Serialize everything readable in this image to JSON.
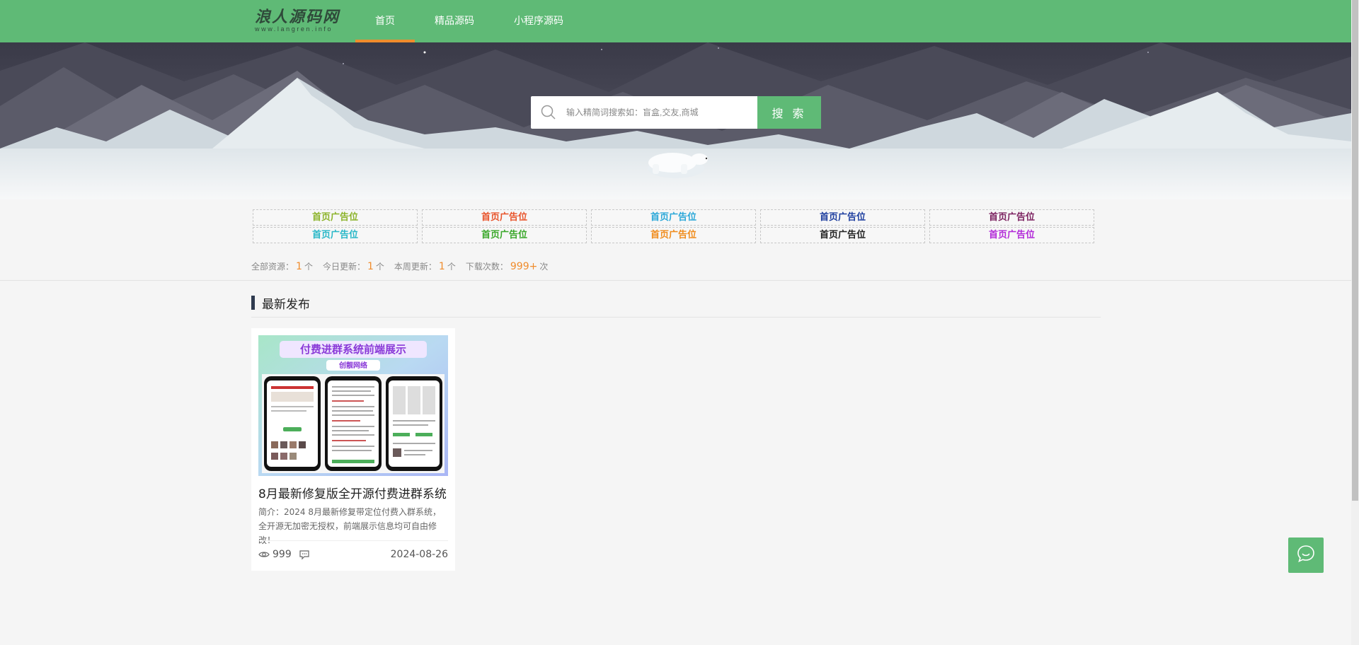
{
  "header": {
    "logo_text": "浪人源码网",
    "logo_sub": "www.langren.info",
    "nav": [
      {
        "label": "首页",
        "active": true
      },
      {
        "label": "精品源码",
        "active": false
      },
      {
        "label": "小程序源码",
        "active": false
      }
    ]
  },
  "search": {
    "placeholder": "输入精简词搜索如：盲盒,交友,商城",
    "button_label": "搜 索"
  },
  "ads": [
    {
      "label": "首页广告位",
      "color": "#8cb32a"
    },
    {
      "label": "首页广告位",
      "color": "#e8532a"
    },
    {
      "label": "首页广告位",
      "color": "#2aa7d8"
    },
    {
      "label": "首页广告位",
      "color": "#1c3d9e"
    },
    {
      "label": "首页广告位",
      "color": "#7a1f5e"
    },
    {
      "label": "首页广告位",
      "color": "#2ab8c8"
    },
    {
      "label": "首页广告位",
      "color": "#3aa82a"
    },
    {
      "label": "首页广告位",
      "color": "#f08c1c"
    },
    {
      "label": "首页广告位",
      "color": "#222222"
    },
    {
      "label": "首页广告位",
      "color": "#b22ad8"
    }
  ],
  "stats": {
    "total_label": "全部资源：",
    "total_value": "1",
    "total_unit": "个",
    "today_label": "今日更新：",
    "today_value": "1",
    "today_unit": "个",
    "week_label": "本周更新：",
    "week_value": "1",
    "week_unit": "个",
    "downloads_label": "下载次数：",
    "downloads_value": "999+",
    "downloads_unit": "次"
  },
  "section": {
    "title": "最新发布"
  },
  "card": {
    "thumb_title": "付费进群系统前端展示",
    "thumb_sub": "创靓网络",
    "title": "8月最新修复版全开源付费进群系统",
    "description": "简介：2024 8月最新修复带定位付费入群系统，全开源无加密无授权，前端展示信息均可自由修改！",
    "views": "999",
    "date": "2024-08-26"
  },
  "colors": {
    "brand": "#5fba76",
    "accent": "#f08c2c"
  },
  "icons": {
    "search": "search-icon",
    "views": "eye-icon",
    "comments": "comment-icon",
    "chat": "chat-bubble-icon"
  }
}
